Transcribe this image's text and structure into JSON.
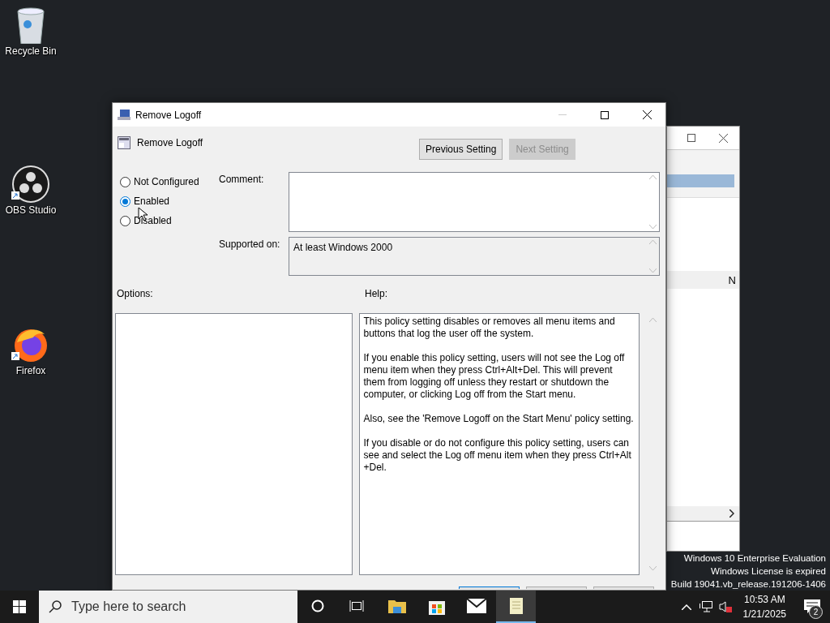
{
  "desktop": {
    "icons": [
      {
        "label": "Recycle Bin",
        "kind": "recycle-bin",
        "shortcut": false
      },
      {
        "label": "OBS Studio",
        "kind": "obs",
        "shortcut": true
      },
      {
        "label": "Firefox",
        "kind": "firefox",
        "shortcut": true
      }
    ],
    "activation_notice": [
      "Windows 10 Enterprise Evaluation",
      "Windows License is expired",
      "Build 19041.vb_release.191206-1406"
    ]
  },
  "back_window": {
    "column_label": "N"
  },
  "dialog": {
    "title": "Remove Logoff",
    "setting_name": "Remove Logoff",
    "nav_buttons": [
      {
        "label": "Previous Setting",
        "disabled": false
      },
      {
        "label": "Next Setting",
        "disabled": true
      }
    ],
    "states": [
      {
        "label": "Not Configured",
        "selected": false
      },
      {
        "label": "Enabled",
        "selected": true
      },
      {
        "label": "Disabled",
        "selected": false
      }
    ],
    "comment": {
      "label": "Comment:"
    },
    "supported_on": {
      "label": "Supported on:",
      "value": "At least Windows 2000"
    },
    "options_label": "Options:",
    "help_label": "Help:",
    "help_paragraphs": [
      "This policy setting disables or removes all menu items and buttons that log the user off the system.",
      "If you enable this policy setting, users will not see the Log off menu item when they press Ctrl+Alt+Del. This will prevent them from logging off unless they restart or shutdown the computer, or clicking Log off from the Start menu.",
      "Also, see the 'Remove Logoff on the Start Menu' policy setting.",
      "If you disable or do not configure this policy setting, users can see and select the Log off menu item when they press Ctrl+Alt +Del."
    ]
  },
  "taskbar": {
    "search_placeholder": "Type here to search",
    "apps": [
      {
        "kind": "cortana",
        "active": false
      },
      {
        "kind": "task-view",
        "active": false
      },
      {
        "kind": "folder",
        "active": false
      },
      {
        "kind": "store",
        "active": false
      },
      {
        "kind": "mail",
        "active": false
      },
      {
        "kind": "notepad",
        "active": true
      }
    ],
    "time": "10:53 AM",
    "date": "1/21/2025",
    "notification_count": "2"
  }
}
